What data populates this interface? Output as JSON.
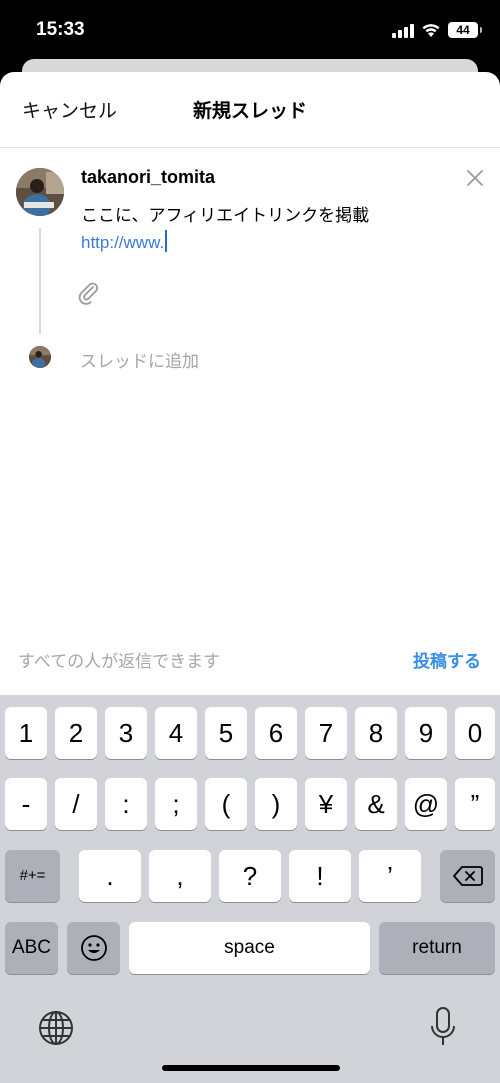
{
  "status_bar": {
    "time": "15:33",
    "battery": "44",
    "icons": [
      "signal-icon",
      "wifi-icon",
      "battery-icon"
    ]
  },
  "header": {
    "cancel_label": "キャンセル",
    "title": "新規スレッド"
  },
  "post": {
    "username": "takanori_tomita",
    "text": "ここに、アフィリエイトリンクを掲載",
    "link": "http://www."
  },
  "thread": {
    "add_placeholder": "スレッドに追加"
  },
  "footer": {
    "reply_setting": "すべての人が返信できます",
    "post_label": "投稿する"
  },
  "keyboard": {
    "row1": [
      "1",
      "2",
      "3",
      "4",
      "5",
      "6",
      "7",
      "8",
      "9",
      "0"
    ],
    "row2": [
      "-",
      "/",
      ":",
      ";",
      "(",
      ")",
      "¥",
      "&",
      "@",
      "”"
    ],
    "row3_left": "#+=",
    "row3": [
      ".",
      ",",
      "?",
      "!",
      "’"
    ],
    "abc": "ABC",
    "space": "space",
    "return": "return"
  },
  "colors": {
    "link": "#3a7bd5",
    "post_button": "#3a8ee6",
    "keyboard_bg": "#d2d3d8"
  }
}
